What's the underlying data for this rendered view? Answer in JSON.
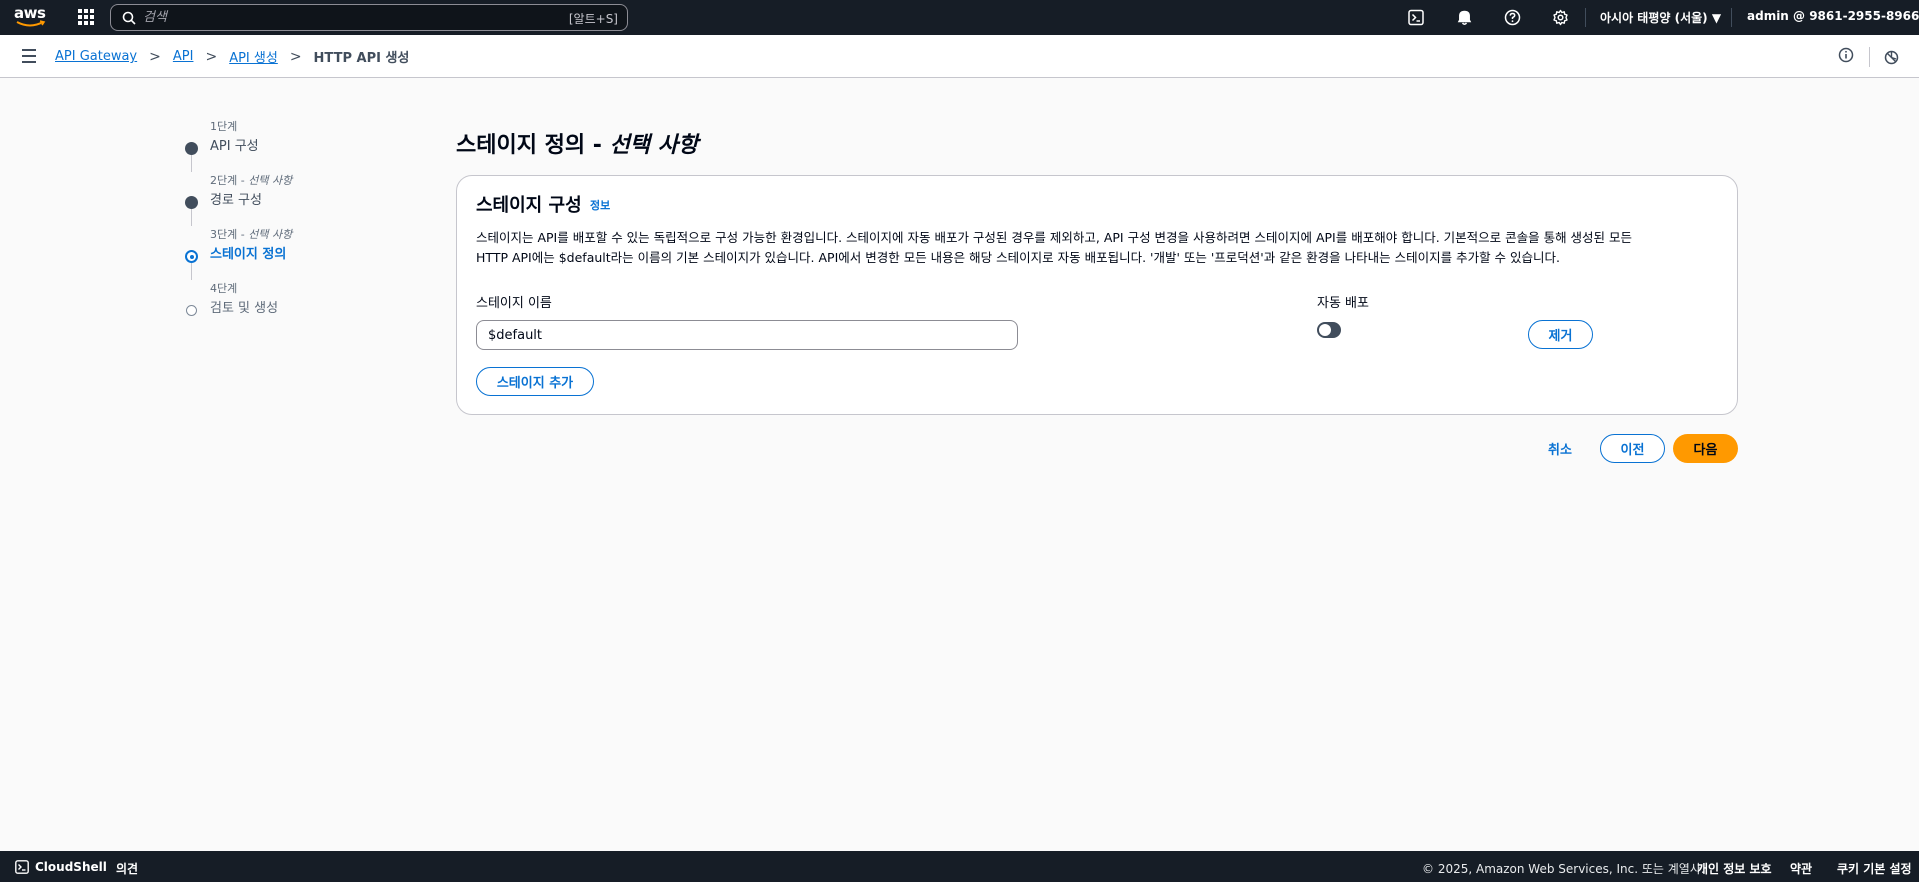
{
  "topnav": {
    "logo_text": "aws",
    "search_placeholder": "검색",
    "search_shortcut": "[알트+S]",
    "region": "아시아 태평양 (서울) ▼",
    "account": "admin @ 9861-2955-8966 ▼",
    "icons": [
      "services-grid-icon",
      "search-icon",
      "cloudshell-icon",
      "bell-icon",
      "help-icon",
      "gear-icon"
    ]
  },
  "breadcrumb": {
    "items": [
      "API Gateway",
      "API",
      "API 생성"
    ],
    "current": "HTTP API 생성"
  },
  "steps": [
    {
      "num": "1단계",
      "optional": "",
      "label": "API 구성",
      "state": "done"
    },
    {
      "num": "2단계",
      "optional": "선택 사항",
      "label": "경로 구성",
      "state": "done"
    },
    {
      "num": "3단계",
      "optional": "선택 사항",
      "label": "스테이지 정의",
      "state": "active"
    },
    {
      "num": "4단계",
      "optional": "",
      "label": "검토 및 생성",
      "state": "todo"
    }
  ],
  "step_sep": " - ",
  "page": {
    "title": "스테이지 정의 - ",
    "title_italic": "선택 사항"
  },
  "container": {
    "title": "스테이지 구성",
    "info": "정보",
    "desc_line1": "스테이지는 API를 배포할 수 있는 독립적으로 구성 가능한 환경입니다. 스테이지에 자동 배포가 구성된 경우를 제외하고, API 구성 변경을 사용하려면 스테이지에 API를 배포해야 합니다. 기본적으로 콘솔을 통해 생성된 모든",
    "desc_line2": "HTTP API에는 $default라는 이름의 기본 스테이지가 있습니다. API에서 변경한 모든 내용은 해당 스테이지로 자동 배포됩니다. '개발' 또는 '프로덕션'과 같은 환경을 나타내는 스테이지를 추가할 수 있습니다.",
    "stage_name_label": "스테이지 이름",
    "stage_name_value": "$default",
    "auto_deploy_label": "자동 배포",
    "auto_deploy_on": false,
    "remove_button": "제거",
    "add_stage_button": "스테이지 추가"
  },
  "actions": {
    "cancel": "취소",
    "previous": "이전",
    "next": "다음"
  },
  "footer": {
    "cloudshell": "CloudShell",
    "feedback": "의견",
    "copyright": "© 2025, Amazon Web Services, Inc. 또는 계열사.",
    "privacy": "개인 정보 보호",
    "terms": "약관",
    "cookies": "쿠키 기본 설정"
  },
  "colors": {
    "nav_bg": "#161d26",
    "link": "#0972d3",
    "primary": "#ff9900"
  }
}
